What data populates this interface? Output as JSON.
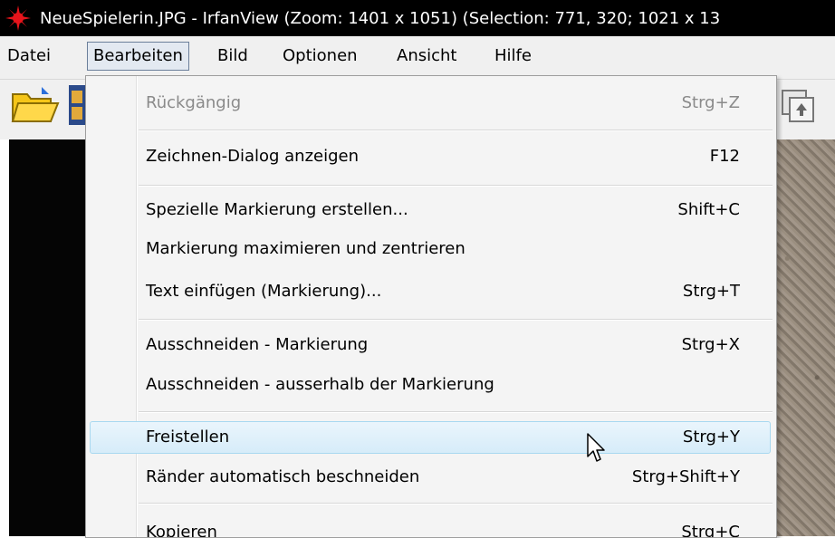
{
  "window": {
    "title": "NeueSpielerin.JPG - IrfanView (Zoom: 1401 x 1051) (Selection: 771, 320; 1021 x 13",
    "app_icon": "irfanview-icon"
  },
  "menubar": {
    "items": [
      {
        "label": "Datei"
      },
      {
        "label": "Bearbeiten"
      },
      {
        "label": "Bild"
      },
      {
        "label": "Optionen"
      },
      {
        "label": "Ansicht"
      },
      {
        "label": "Hilfe"
      }
    ],
    "active": "Bearbeiten"
  },
  "toolbar": {
    "icons": [
      "open-folder-icon",
      "filmstrip-icon",
      "copy-icon"
    ]
  },
  "edit_menu": {
    "items": [
      {
        "label": "Rückgängig",
        "shortcut": "Strg+Z",
        "enabled": false
      },
      {
        "label": "Zeichnen-Dialog anzeigen",
        "shortcut": "F12"
      },
      {
        "label": "Spezielle Markierung erstellen...",
        "shortcut": "Shift+C"
      },
      {
        "label": "Markierung maximieren und zentrieren",
        "shortcut": ""
      },
      {
        "label": "Text einfügen (Markierung)...",
        "shortcut": "Strg+T"
      },
      {
        "label": "Ausschneiden - Markierung",
        "shortcut": "Strg+X"
      },
      {
        "label": "Ausschneiden - ausserhalb der Markierung",
        "shortcut": ""
      },
      {
        "label": "Freistellen",
        "shortcut": "Strg+Y",
        "highlighted": true
      },
      {
        "label": "Ränder automatisch beschneiden",
        "shortcut": "Strg+Shift+Y"
      },
      {
        "label": "Kopieren",
        "shortcut": "Strg+C"
      }
    ]
  },
  "colors": {
    "highlight_border": "#a8d8f0",
    "highlight_fill": "#d6ecf9",
    "disabled_text": "#8a8a8a"
  }
}
